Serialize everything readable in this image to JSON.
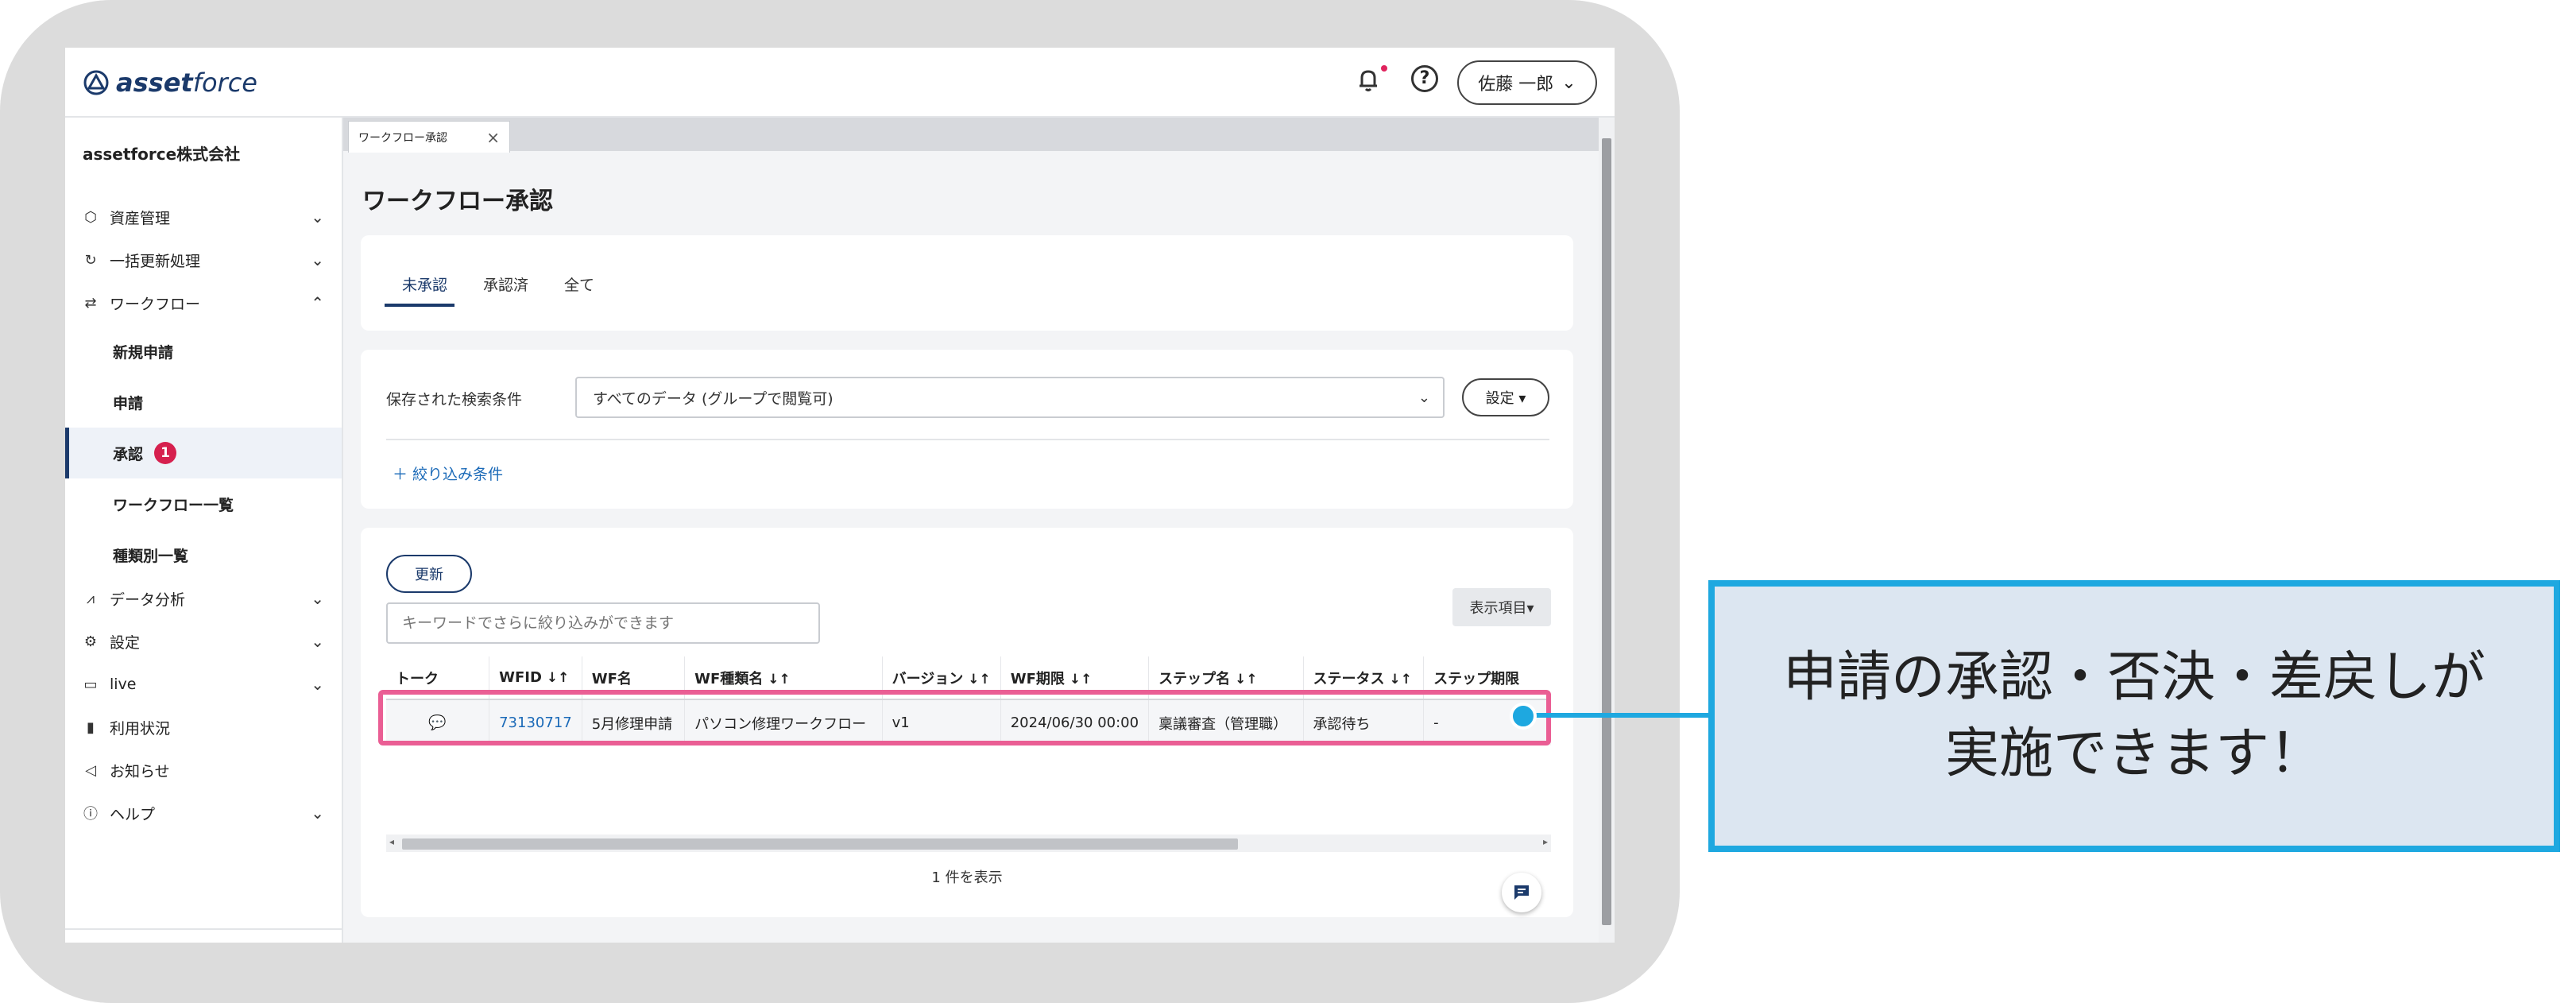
{
  "app": {
    "logo_bold": "asset",
    "logo_light": "force",
    "user_name": "佐藤 一郎"
  },
  "sidebar": {
    "company": "assetforce株式会社",
    "items": [
      {
        "label": "資産管理",
        "icon": "cube-icon"
      },
      {
        "label": "一括更新処理",
        "icon": "refresh-icon"
      },
      {
        "label": "ワークフロー",
        "icon": "workflow-icon"
      },
      {
        "label": "データ分析",
        "icon": "analytics-icon"
      },
      {
        "label": "設定",
        "icon": "gear-icon"
      },
      {
        "label": "live",
        "icon": "live-icon"
      },
      {
        "label": "利用状況",
        "icon": "bar-chart-icon"
      },
      {
        "label": "お知らせ",
        "icon": "megaphone-icon"
      },
      {
        "label": "ヘルプ",
        "icon": "help-icon"
      }
    ],
    "sub_items": [
      {
        "label": "新規申請"
      },
      {
        "label": "申請"
      },
      {
        "label": "承認",
        "badge": "1"
      },
      {
        "label": "ワークフロー一覧"
      },
      {
        "label": "種類別一覧"
      }
    ],
    "collapse_icon": "collapse-left-icon"
  },
  "main": {
    "tab_label": "ワークフロー承認",
    "page_title": "ワークフロー承認",
    "status_tabs": [
      "未承認",
      "承認済",
      "全て"
    ],
    "active_status_tab": "未承認",
    "saved_search_label": "保存された検索条件",
    "saved_search_value": "すべてのデータ (グループで閲覧可)",
    "settings_button": "設定 ▾",
    "filter_button": "＋ 絞り込み条件",
    "refresh_button": "更新",
    "keyword_placeholder": "キーワードでさらに絞り込みができます",
    "columns_button": "表示項目▾",
    "table": {
      "headers": [
        "トーク",
        "WFID",
        "WF名",
        "WF種類名",
        "バージョン",
        "WF期限",
        "ステップ名",
        "ステータス",
        "ステップ期限"
      ],
      "sortable": [
        false,
        true,
        false,
        true,
        true,
        true,
        true,
        true,
        false
      ],
      "rows": [
        [
          "💬",
          "73130717",
          "5月修理申請",
          "パソコン修理ワークフロー",
          "v1",
          "2024/06/30 00:00",
          "稟議審査（管理職）",
          "承認待ち",
          "-"
        ]
      ]
    },
    "count_text": "1 件を表示"
  },
  "callout": {
    "line1": "申請の承認・否決・差戻しが",
    "line2": "実施できます！"
  },
  "colors": {
    "brand": "#1b3a6b",
    "highlight": "#ea5e94",
    "callout_border": "#1ea8e0",
    "callout_bg": "#dce6f1",
    "badge": "#d6204e"
  }
}
